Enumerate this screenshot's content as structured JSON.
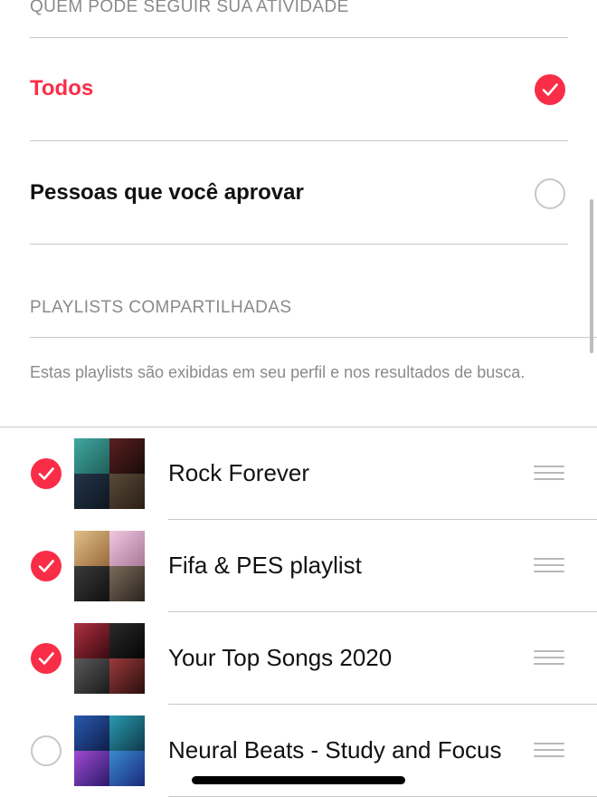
{
  "follow_section": {
    "header": "QUEM PODE SEGUIR SUA ATIVIDADE",
    "options": [
      {
        "label": "Todos",
        "selected": true
      },
      {
        "label": "Pessoas que você aprovar",
        "selected": false
      }
    ]
  },
  "playlists_section": {
    "header": "PLAYLISTS COMPARTILHADAS",
    "footnote": "Estas playlists são exibidas em seu perfil e nos resultados de busca.",
    "items": [
      {
        "title": "Rock Forever",
        "checked": true,
        "cover_colors": [
          "#2f8f8a",
          "#3a1a18",
          "#1e2a3a",
          "#4a3a2a"
        ]
      },
      {
        "title": "Fifa & PES playlist",
        "checked": true,
        "cover_colors": [
          "#c9a46a",
          "#d8a6c6",
          "#2a2a2a",
          "#6a5a4a"
        ]
      },
      {
        "title": "Your Top Songs 2020",
        "checked": true,
        "cover_colors": [
          "#8a2030",
          "#1a1a1a",
          "#3a3a3a",
          "#7a2a2a"
        ]
      },
      {
        "title": "Neural Beats - Study and Focus",
        "checked": false,
        "cover_colors": [
          "#1a3a8a",
          "#1a6a8a",
          "#7a3ab0",
          "#2a6ab0"
        ]
      }
    ]
  },
  "colors": {
    "accent": "#fa2d48",
    "secondary_text": "#8a8a8e",
    "separator": "#c9c9cc"
  },
  "icons": {
    "selected": "checkmark-circle-icon",
    "unselected": "empty-circle-icon",
    "reorder": "drag-handle-icon"
  }
}
